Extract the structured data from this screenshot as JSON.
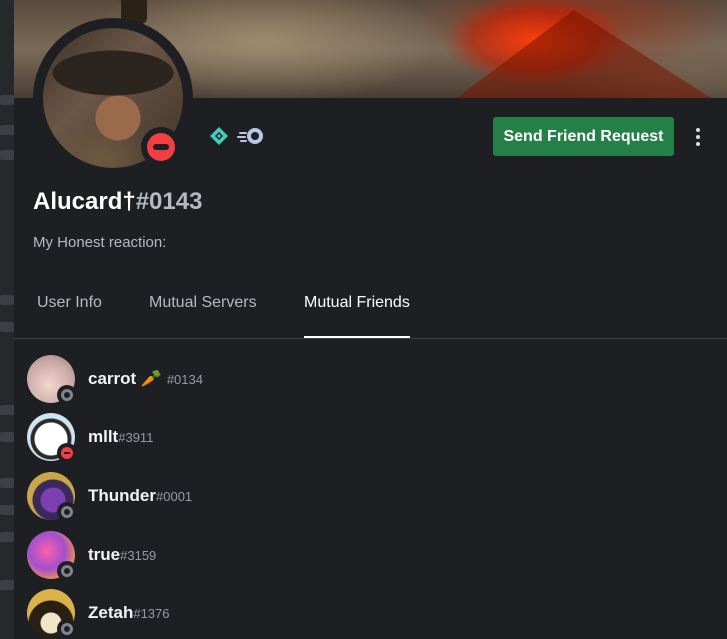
{
  "profile": {
    "username": "Alucard†",
    "discriminator": "#0143",
    "bio": "My Honest reaction:",
    "status": "do-not-disturb",
    "badges": [
      "hypesquad-icon",
      "nitro-icon"
    ]
  },
  "actions": {
    "send_friend_request": "Send Friend Request",
    "more_icon": "more-vertical-icon"
  },
  "tabs": [
    {
      "label": "User Info",
      "active": false
    },
    {
      "label": "Mutual Servers",
      "active": false
    },
    {
      "label": "Mutual Friends",
      "active": true
    }
  ],
  "mutual_friends": [
    {
      "name": "carrot 🥕",
      "tag": "#0134",
      "status": "offline"
    },
    {
      "name": "mllt",
      "tag": "#3911",
      "status": "dnd"
    },
    {
      "name": "Thunder",
      "tag": "#0001",
      "status": "offline"
    },
    {
      "name": "true",
      "tag": "#3159",
      "status": "offline"
    },
    {
      "name": "Zetah",
      "tag": "#1376",
      "status": "offline"
    }
  ],
  "colors": {
    "accent_green": "#248046",
    "dnd_red": "#f23f43",
    "offline_grey": "#80848e",
    "background": "#1e1f22"
  }
}
